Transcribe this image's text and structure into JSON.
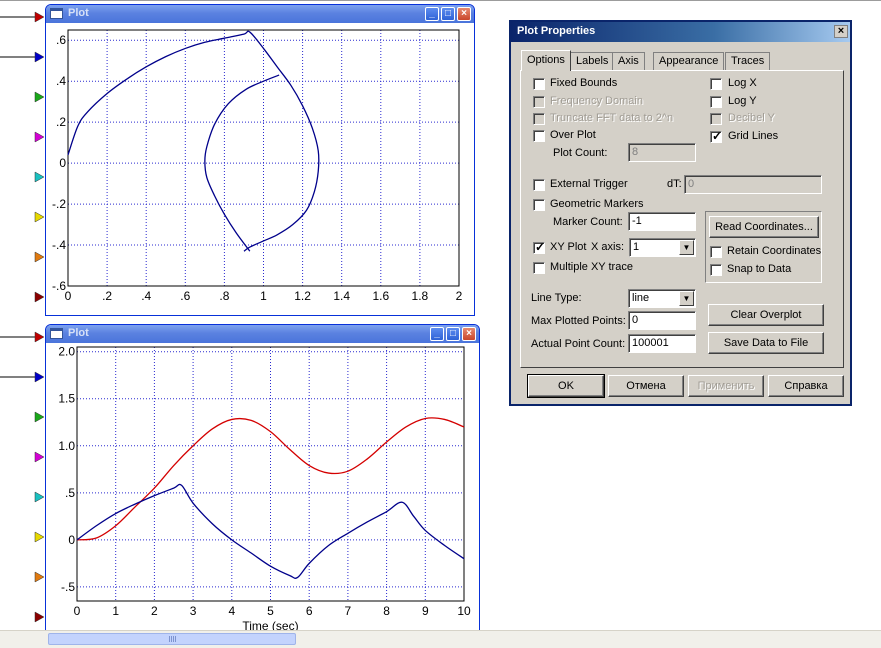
{
  "plot1": {
    "title": "Plot",
    "xticks": [
      "0",
      ".2",
      ".4",
      ".6",
      ".8",
      "1",
      "1.2",
      "1.4",
      "1.6",
      "1.8",
      "2"
    ],
    "yticks": [
      ".6",
      ".4",
      ".2",
      "0",
      "-.2",
      "-.4",
      "-.6"
    ]
  },
  "plot2": {
    "title": "Plot",
    "xticks": [
      "0",
      "1",
      "2",
      "3",
      "4",
      "5",
      "6",
      "7",
      "8",
      "9",
      "10"
    ],
    "yticks": [
      "2.0",
      "1.5",
      "1.0",
      ".5",
      "0",
      "-.5"
    ],
    "xlabel": "Time (sec)"
  },
  "chart_data": [
    {
      "type": "line",
      "title": "Plot",
      "xlim": [
        0,
        2
      ],
      "ylim": [
        -0.6,
        0.65
      ],
      "grid": true,
      "series": [
        {
          "color": "#00008b",
          "x": [
            0,
            0.05,
            0.1,
            0.2,
            0.3,
            0.4,
            0.5,
            0.6,
            0.7,
            0.8,
            0.9,
            0.93,
            1.0,
            1.07,
            1.14,
            1.2,
            1.25,
            1.28,
            1.28,
            1.26,
            1.22,
            1.15,
            1.07,
            1.0,
            0.93,
            0.9
          ],
          "y": [
            0.04,
            0.18,
            0.25,
            0.34,
            0.41,
            0.47,
            0.52,
            0.56,
            0.59,
            0.61,
            0.63,
            0.64,
            0.56,
            0.47,
            0.38,
            0.28,
            0.17,
            0.06,
            -0.04,
            -0.14,
            -0.23,
            -0.3,
            -0.35,
            -0.38,
            -0.41,
            -0.43
          ]
        },
        {
          "color": "#00008b",
          "x": [
            0.93,
            0.86,
            0.8,
            0.75,
            0.71,
            0.7,
            0.71,
            0.75,
            0.82,
            0.91,
            1.0,
            1.08
          ],
          "y": [
            -0.43,
            -0.34,
            -0.25,
            -0.16,
            -0.07,
            0.01,
            0.08,
            0.19,
            0.29,
            0.36,
            0.4,
            0.43
          ]
        }
      ]
    },
    {
      "type": "line",
      "title": "Plot",
      "xlabel": "Time (sec)",
      "xlim": [
        0,
        10
      ],
      "ylim": [
        -0.65,
        2.05
      ],
      "grid": true,
      "series": [
        {
          "color": "#d40000",
          "x": [
            0,
            0.5,
            1,
            1.5,
            2,
            2.5,
            3,
            3.5,
            4,
            4.5,
            5,
            5.5,
            6,
            6.5,
            7,
            7.5,
            8,
            8.5,
            9,
            9.5,
            10
          ],
          "y": [
            0,
            0.02,
            0.15,
            0.35,
            0.55,
            0.79,
            1.0,
            1.18,
            1.28,
            1.27,
            1.15,
            0.96,
            0.79,
            0.71,
            0.73,
            0.86,
            1.04,
            1.2,
            1.29,
            1.28,
            1.2
          ]
        },
        {
          "color": "#00008b",
          "x": [
            0,
            0.5,
            1,
            1.5,
            2,
            2.5,
            2.7,
            3,
            3.5,
            4,
            4.5,
            5,
            5.5,
            5.7,
            6,
            6.5,
            7,
            7.5,
            8,
            8.4,
            8.7,
            9,
            9.5,
            10
          ],
          "y": [
            0,
            0.15,
            0.28,
            0.38,
            0.47,
            0.55,
            0.58,
            0.39,
            0.17,
            0.0,
            -0.14,
            -0.28,
            -0.38,
            -0.4,
            -0.25,
            -0.06,
            0.07,
            0.19,
            0.3,
            0.4,
            0.25,
            0.1,
            -0.06,
            -0.2
          ]
        }
      ]
    }
  ],
  "dialog": {
    "title": "Plot Properties",
    "tabs": [
      "Options",
      "Labels",
      "Axis",
      "Appearance",
      "Traces"
    ],
    "fixed_bounds": "Fixed Bounds",
    "frequency_domain": "Frequency Domain",
    "truncate_fft": "Truncate FFT data to 2^n",
    "over_plot": "Over Plot",
    "plot_count_label": "Plot Count:",
    "plot_count_value": "8",
    "log_x": "Log X",
    "log_y": "Log Y",
    "decibel_y": "Decibel Y",
    "grid_lines": "Grid Lines",
    "external_trigger": "External Trigger",
    "dt_label": "dT:",
    "dt_value": "0",
    "geometric_markers": "Geometric Markers",
    "marker_count_label": "Marker Count:",
    "marker_count_value": "-1",
    "read_coordinates": "Read Coordinates...",
    "retain_coordinates": "Retain Coordinates",
    "snap_to_data": "Snap to Data",
    "xy_plot": "XY Plot",
    "x_axis_label": "X axis:",
    "x_axis_value": "1",
    "multiple_xy_trace": "Multiple XY trace",
    "line_type_label": "Line Type:",
    "line_type_value": "line",
    "max_plotted_points_label": "Max Plotted Points:",
    "max_plotted_points_value": "0",
    "actual_point_count_label": "Actual Point Count:",
    "actual_point_count_value": "100001",
    "clear_overplot": "Clear Overplot",
    "save_data": "Save Data to File",
    "ok": "OK",
    "cancel": "Отмена",
    "apply": "Применить",
    "help": "Справка"
  },
  "colors": {
    "pin_colors": [
      "#c00000",
      "#0000c8",
      "#1aa81a",
      "#d400d4",
      "#19c0c0",
      "#e6d800",
      "#e07a10",
      "#8b0000"
    ]
  }
}
